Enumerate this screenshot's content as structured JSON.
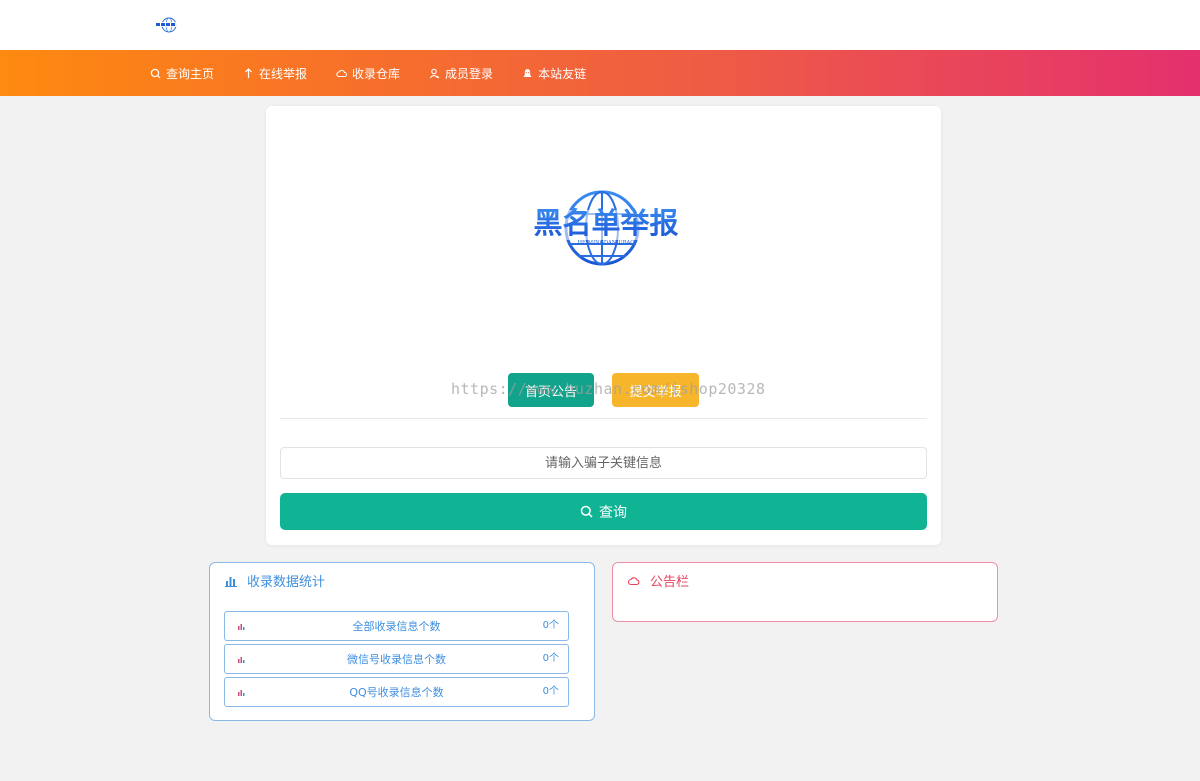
{
  "header": {
    "logo_icon": "globe-logo-icon"
  },
  "nav": {
    "items": [
      {
        "label": "查询主页",
        "icon": "search-icon"
      },
      {
        "label": "在线举报",
        "icon": "upload-arrow-icon"
      },
      {
        "label": "收录仓库",
        "icon": "cloud-icon"
      },
      {
        "label": "成员登录",
        "icon": "user-icon"
      },
      {
        "label": "本站友链",
        "icon": "link-icon"
      }
    ]
  },
  "main": {
    "logo_text": "黑名单举报",
    "logo_subtext": "HEIMINGDANJUBAO",
    "notice_button": "首页公告",
    "report_button": "提交举报",
    "watermark": "https://www.huzhan.com/ishop20328",
    "search": {
      "placeholder": "请输入骗子关键信息"
    },
    "query_button": "查询"
  },
  "stats": {
    "title": "收录数据统计",
    "rows": [
      {
        "label": "全部收录信息个数",
        "count": "0个"
      },
      {
        "label": "微信号收录信息个数",
        "count": "0个"
      },
      {
        "label": "QQ号收录信息个数",
        "count": "0个"
      }
    ]
  },
  "notice": {
    "title": "公告栏"
  },
  "colors": {
    "nav_gradient_start": "#fe8a10",
    "nav_gradient_end": "#e4306f",
    "primary_green": "#10b495",
    "orange": "#f7b52c",
    "stats_blue": "#3f8fdf",
    "notice_red": "#e6445e"
  }
}
